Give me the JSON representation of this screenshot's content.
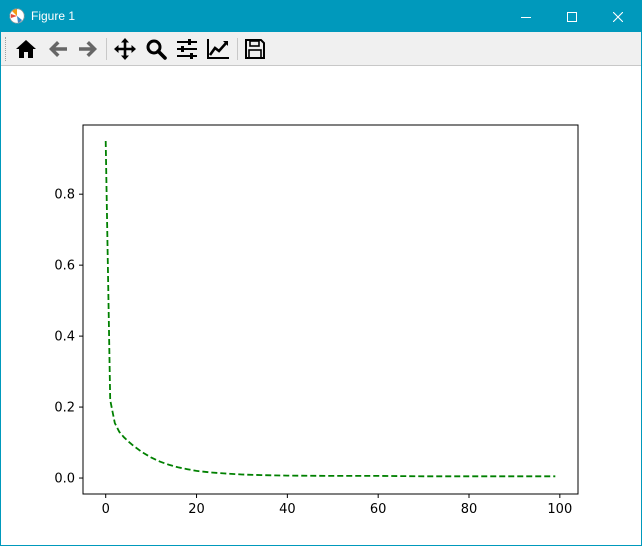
{
  "window": {
    "title": "Figure 1",
    "controls": {
      "minimize": "minimize-icon",
      "maximize": "maximize-icon",
      "close": "close-icon"
    }
  },
  "toolbar": {
    "tools": [
      {
        "name": "home",
        "icon": "home-icon"
      },
      {
        "name": "back",
        "icon": "arrow-left-icon"
      },
      {
        "name": "forward",
        "icon": "arrow-right-icon"
      },
      {
        "name": "pan",
        "icon": "move-icon"
      },
      {
        "name": "zoom",
        "icon": "magnifier-icon"
      },
      {
        "name": "subplots",
        "icon": "sliders-icon"
      },
      {
        "name": "edit-axis",
        "icon": "line-chart-icon"
      },
      {
        "name": "save",
        "icon": "floppy-disk-icon"
      }
    ]
  },
  "colors": {
    "titlebar": "#0099bc",
    "toolbar": "#f0f0f0",
    "line": "#008000"
  },
  "chart_data": {
    "type": "line",
    "title": "",
    "xlabel": "",
    "ylabel": "",
    "xlim": [
      -5,
      104
    ],
    "ylim": [
      -0.045,
      0.995
    ],
    "xticks": [
      0,
      20,
      40,
      60,
      80,
      100
    ],
    "yticks": [
      0.0,
      0.2,
      0.4,
      0.6,
      0.8
    ],
    "xtick_labels": [
      "0",
      "20",
      "40",
      "60",
      "80",
      "100"
    ],
    "ytick_labels": [
      "0.0",
      "0.2",
      "0.4",
      "0.6",
      "0.8"
    ],
    "grid": false,
    "series": [
      {
        "line_style": "dashed",
        "color": "#008000",
        "x": [
          0,
          1,
          2,
          3,
          4,
          5,
          6,
          8,
          10,
          12,
          14,
          16,
          18,
          20,
          23,
          26,
          30,
          35,
          40,
          50,
          60,
          70,
          80,
          90,
          99
        ],
        "y": [
          0.95,
          0.22,
          0.155,
          0.13,
          0.115,
          0.103,
          0.092,
          0.073,
          0.058,
          0.046,
          0.037,
          0.03,
          0.025,
          0.02,
          0.016,
          0.013,
          0.01,
          0.008,
          0.007,
          0.006,
          0.006,
          0.005,
          0.005,
          0.005,
          0.005
        ]
      }
    ]
  }
}
